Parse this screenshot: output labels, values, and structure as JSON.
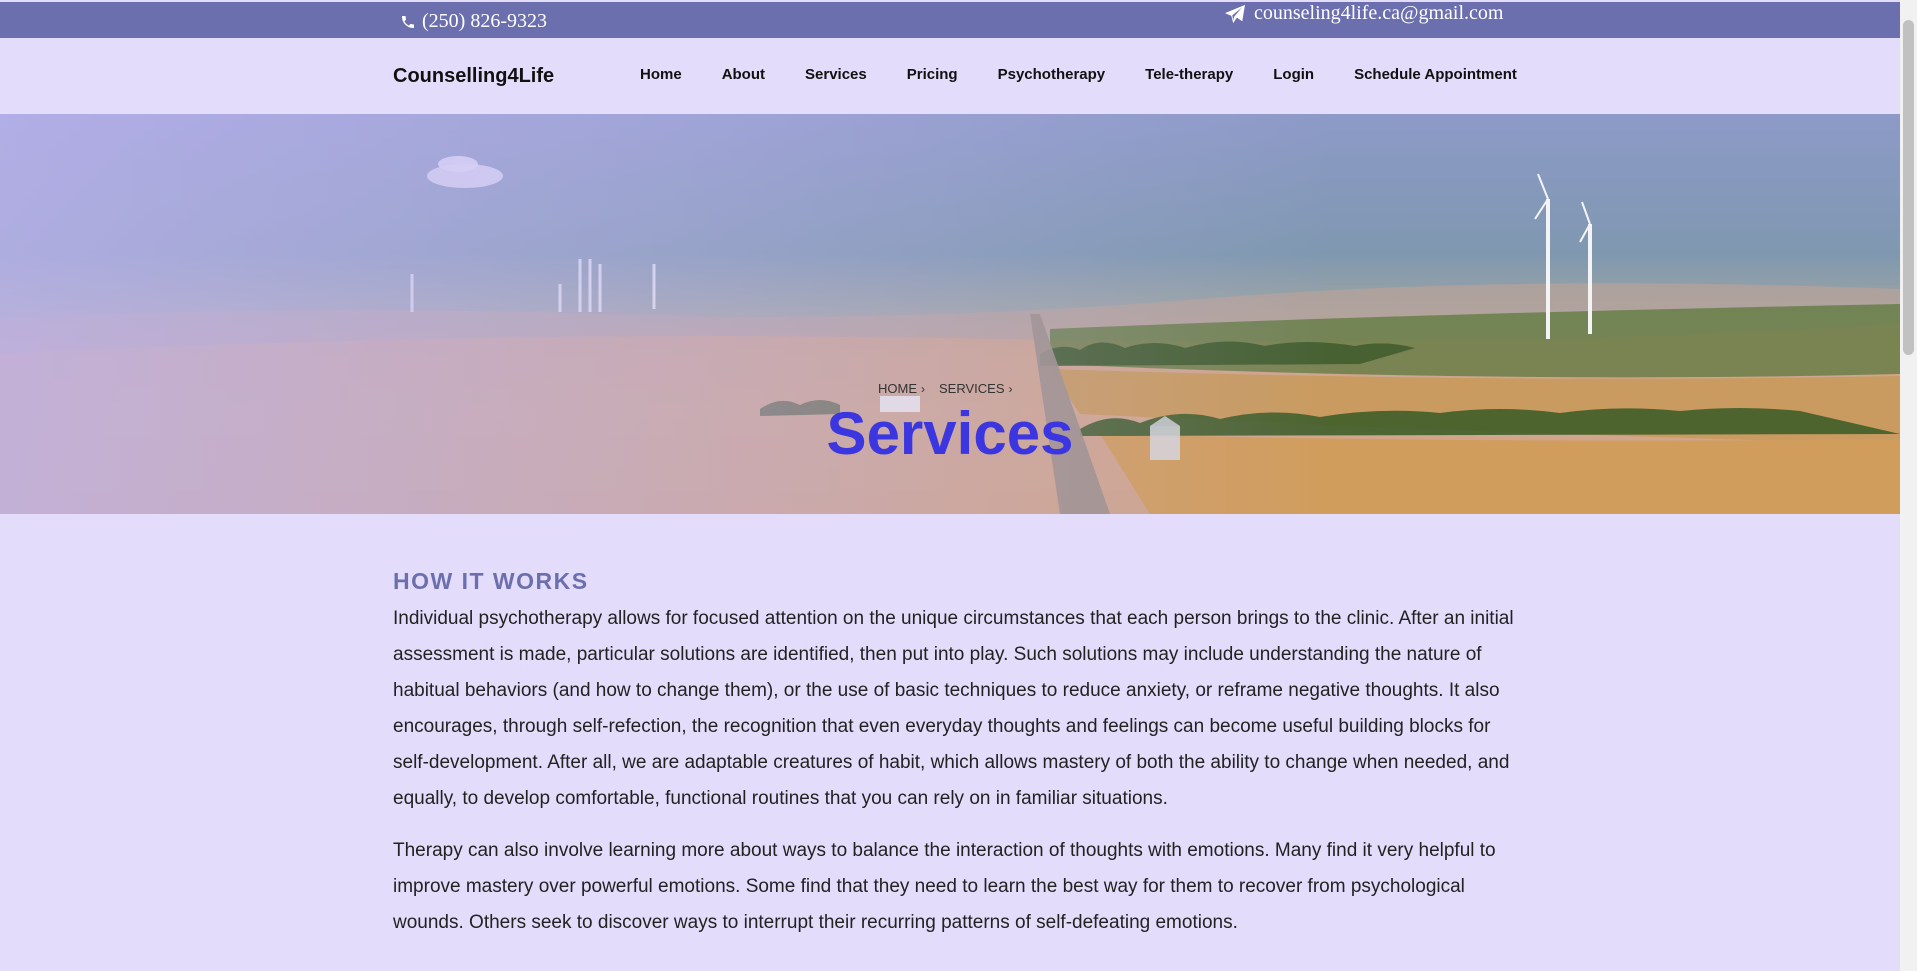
{
  "topbar": {
    "phone": "(250) 826-9323",
    "email": "counseling4life.ca@gmail.com"
  },
  "nav": {
    "brand": "Counselling4Life",
    "items": [
      "Home",
      "About",
      "Services",
      "Pricing",
      "Psychotherapy",
      "Tele-therapy",
      "Login",
      "Schedule Appointment"
    ]
  },
  "hero": {
    "breadcrumb": [
      "HOME",
      "SERVICES"
    ],
    "title": "Services"
  },
  "content": {
    "heading": "HOW IT WORKS",
    "paragraphs": [
      "Individual psychotherapy allows for focused attention on the unique circumstances that each person brings to the clinic. After an initial assessment is made, particular solutions are identified, then put into play. Such solutions may include understanding the nature of habitual behaviors (and how to change them), or the use of basic techniques to reduce anxiety, or reframe negative thoughts. It also encourages, through self-refection, the recognition that even everyday thoughts and feelings can become useful building blocks for self-development. After all, we are adaptable creatures of habit, which allows mastery of both the ability to change when needed, and equally, to develop comfortable, functional routines that you can rely on in familiar situations.",
      "Therapy can also involve learning more about ways to balance the interaction of thoughts with emotions. Many find it very helpful to improve mastery over powerful emotions. Some find that they need to learn the best way for them to recover from psychological wounds. Others seek to discover ways to interrupt their recurring patterns of self-defeating emotions."
    ]
  },
  "colors": {
    "topbar": "#6c6fae",
    "background": "#e4dcfb",
    "hero_title": "#3b36e0",
    "heading": "#6c6fae"
  },
  "icons": {
    "phone": "phone-icon",
    "email": "paper-plane-icon",
    "breadcrumb_separator": "chevron-right-icon"
  }
}
